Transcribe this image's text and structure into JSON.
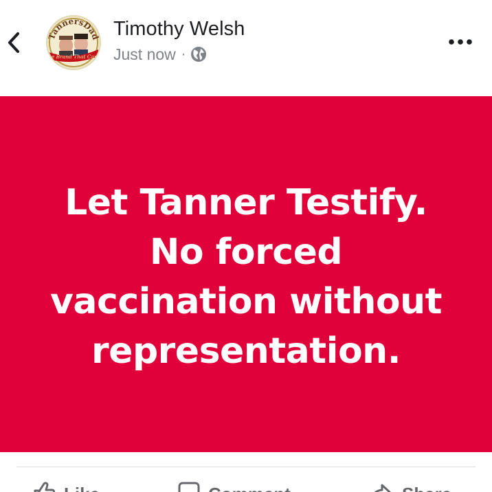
{
  "header": {
    "author_name": "Timothy Welsh",
    "timestamp": "Just now",
    "separator": "·",
    "privacy_icon": "globe-icon",
    "back_icon": "chevron-left-icon",
    "more_icon": "more-horizontal-icon"
  },
  "avatar": {
    "logo_text_top": "TannersDad",
    "logo_text_bottom": "The Brand That Cares"
  },
  "post": {
    "background_color": "#e0003a",
    "text_color": "#ffffff",
    "lines": [
      "Let Tanner Testify.",
      "No forced",
      "vaccination without",
      "representation."
    ]
  },
  "actions": {
    "like_label": "Like",
    "comment_label": "Comment",
    "share_label": "Share",
    "like_icon": "thumbs-up-icon",
    "comment_icon": "comment-icon",
    "share_icon": "share-icon"
  }
}
